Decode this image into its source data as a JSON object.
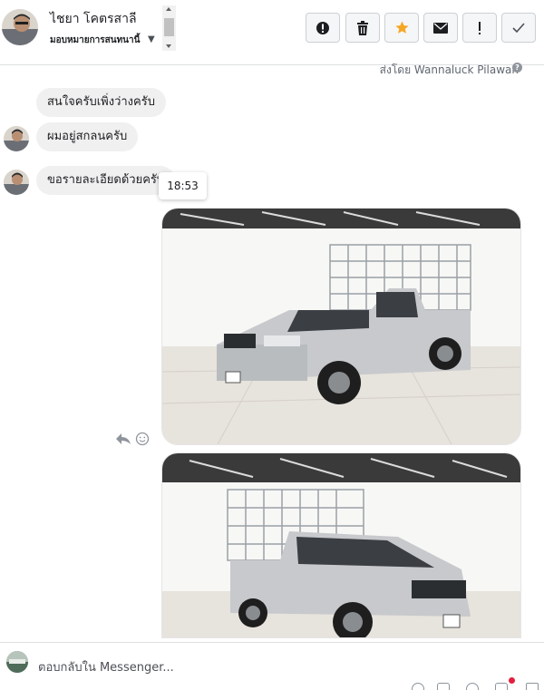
{
  "header": {
    "contact_name": "ไชยา โคตรสาลี",
    "assign_label": "มอบหมายการสนทนานี้",
    "buttons": [
      {
        "name": "mark-spam-button",
        "icon": "alert-circle-icon"
      },
      {
        "name": "delete-button",
        "icon": "trash-icon"
      },
      {
        "name": "star-button",
        "icon": "star-icon"
      },
      {
        "name": "mark-unread-button",
        "icon": "envelope-icon"
      },
      {
        "name": "flag-button",
        "icon": "exclamation-icon"
      },
      {
        "name": "mark-done-button",
        "icon": "check-icon"
      }
    ]
  },
  "assigned_by": "ส่งโดย Wannaluck Pilawan",
  "messages": [
    {
      "text": "สนใจครับเพิ่งว่างครับ"
    },
    {
      "text": "ผมอยู่สกลนครับ"
    },
    {
      "text": "ขอรายละเอียดด้วยครับ"
    }
  ],
  "tooltip_time": "18:53",
  "composer": {
    "placeholder": "ตอบกลับใน Messenger..."
  },
  "colors": {
    "star_accent": "#f5a623",
    "bubble_bg": "#f1f0f0",
    "notification_dot": "#e41e3f"
  }
}
